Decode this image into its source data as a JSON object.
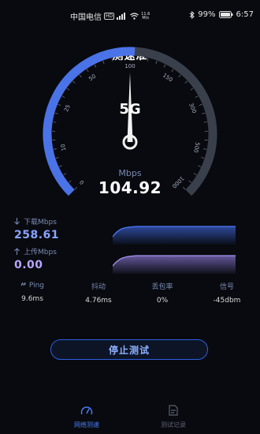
{
  "status_bar": {
    "carrier": "中国电信",
    "hd_badge": "HD",
    "network_speed_value": "11.6",
    "network_speed_unit": "M/s",
    "battery_percent": "99%",
    "time": "6:57",
    "icons": [
      "signal-icon",
      "wifi-icon",
      "bluetooth-icon",
      "battery-icon"
    ]
  },
  "header": {
    "title": "测速准"
  },
  "gauge": {
    "network_type": "5G",
    "unit": "Mbps",
    "value": "104.92",
    "scale_labels": [
      "0",
      "10",
      "25",
      "50",
      "100",
      "150",
      "300",
      "500",
      "1000"
    ],
    "needle_value": 100,
    "progress_value": 104.92,
    "colors": {
      "progress": "#4a73e8",
      "track": "#3a3f4c"
    }
  },
  "download": {
    "label": "下载Mbps",
    "value": "258.61",
    "icon": "arrow-down-icon",
    "color": "#3d63d6"
  },
  "upload": {
    "label": "上传Mbps",
    "value": "0.00",
    "icon": "arrow-up-icon",
    "color": "#8d7ad8"
  },
  "stats": [
    {
      "label": "Ping",
      "value": "9.6ms",
      "icon": "ping-icon"
    },
    {
      "label": "抖动",
      "value": "4.76ms"
    },
    {
      "label": "丢包率",
      "value": "0%"
    },
    {
      "label": "信号",
      "value": "-45dbm"
    }
  ],
  "stop_button": {
    "label": "停止测试"
  },
  "tabbar": {
    "items": [
      {
        "label": "网络测速",
        "icon": "speedometer-icon",
        "active": true
      },
      {
        "label": "测试记录",
        "icon": "document-icon",
        "active": false
      }
    ]
  }
}
